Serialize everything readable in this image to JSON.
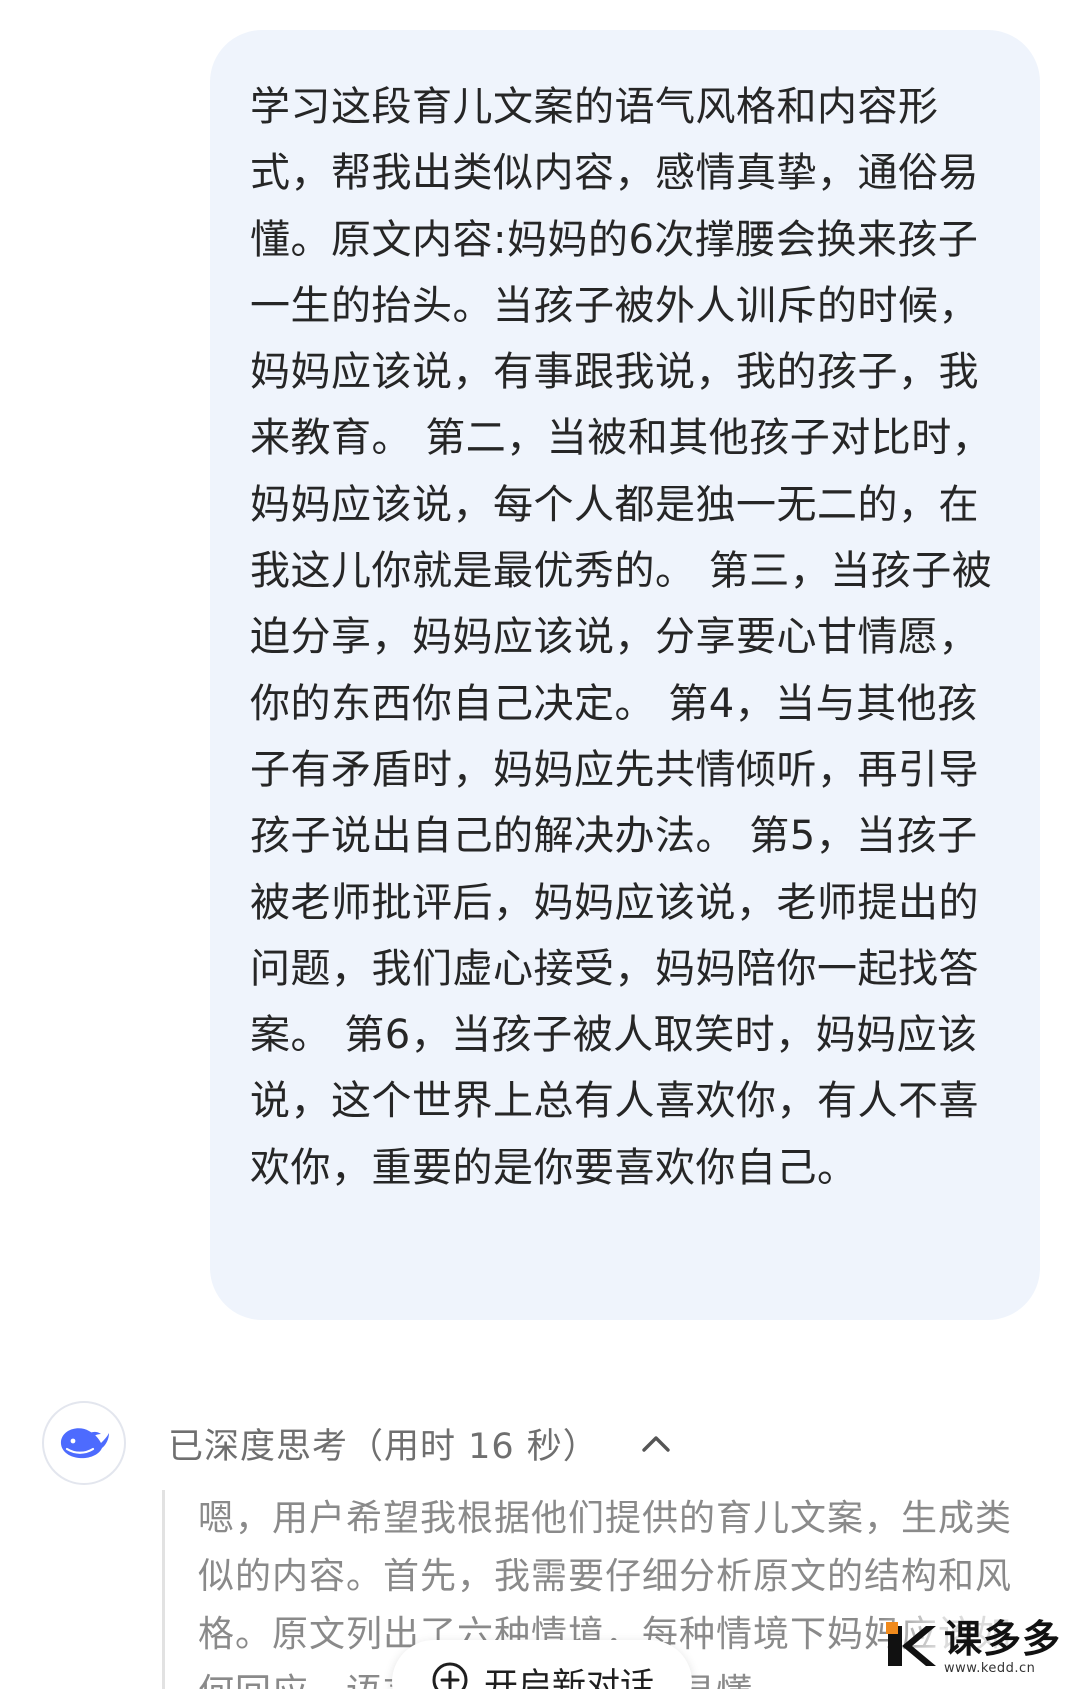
{
  "user_message": {
    "text": "学习这段育儿文案的语气风格和内容形式，帮我出类似内容，感情真挚，通俗易懂。原文内容:妈妈的6次撑腰会换来孩子一生的抬头。当孩子被外人训斥的时候，妈妈应该说，有事跟我说，我的孩子，我来教育。 第二，当被和其他孩子对比时，妈妈应该说，每个人都是独一无二的，在我这儿你就是最优秀的。 第三，当孩子被迫分享，妈妈应该说，分享要心甘情愿，你的东西你自己决定。 第4，当与其他孩子有矛盾时，妈妈应先共情倾听，再引导孩子说出自己的解决办法。 第5，当孩子被老师批评后，妈妈应该说，老师提出的问题，我们虚心接受，妈妈陪你一起找答案。 第6，当孩子被人取笑时，妈妈应该说，这个世界上总有人喜欢你，有人不喜欢你，重要的是你要喜欢你自己。"
  },
  "assistant": {
    "avatar_icon": "whale-logo-icon",
    "thinking_label": "已深度思考（用时 16 秒）",
    "collapse_icon": "chevron-up-icon",
    "thought_text": "嗯，用户希望我根据他们提供的育儿文案，生成类似的内容。首先，我需要仔细分析原文的结构和风格。原文列出了六种情境，每种情境下妈妈应该如何回应，语言感情真挚，通俗易懂。"
  },
  "new_chat_button": {
    "icon": "plus-circle-icon",
    "label": "开启新对话"
  },
  "watermark": {
    "main": "课多多",
    "url": "www.kedd.cn"
  },
  "colors": {
    "bubble_bg": "#eff4fc",
    "brand_blue": "#4d6bfe",
    "muted_text": "#8a8a8a",
    "watermark_orange": "#f08a1c"
  }
}
